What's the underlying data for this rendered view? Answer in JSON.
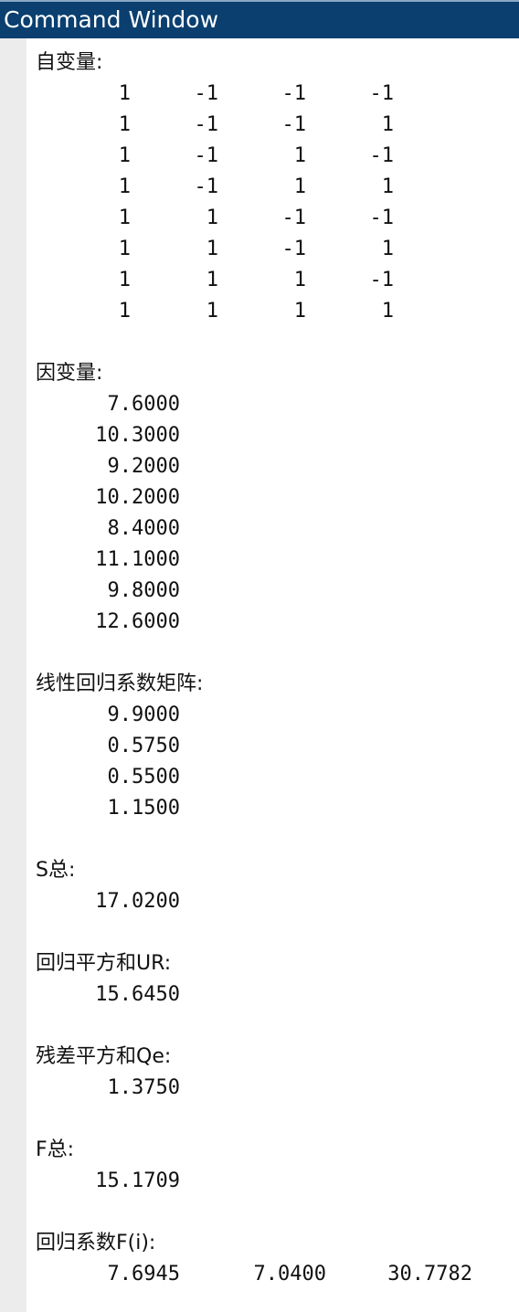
{
  "window": {
    "title": "Command Window"
  },
  "output": {
    "x_label": "自变量:",
    "x_matrix": [
      [
        "1",
        "-1",
        "-1",
        "-1"
      ],
      [
        "1",
        "-1",
        "-1",
        "1"
      ],
      [
        "1",
        "-1",
        "1",
        "-1"
      ],
      [
        "1",
        "-1",
        "1",
        "1"
      ],
      [
        "1",
        "1",
        "-1",
        "-1"
      ],
      [
        "1",
        "1",
        "-1",
        "1"
      ],
      [
        "1",
        "1",
        "1",
        "-1"
      ],
      [
        "1",
        "1",
        "1",
        "1"
      ]
    ],
    "y_label": "因变量:",
    "y_values": [
      "7.6000",
      "10.3000",
      "9.2000",
      "10.2000",
      "8.4000",
      "11.1000",
      "9.8000",
      "12.6000"
    ],
    "coef_label": "线性回归系数矩阵:",
    "coef_values": [
      "9.9000",
      "0.5750",
      "0.5500",
      "1.1500"
    ],
    "s_total_label": "S总:",
    "s_total_value": "17.0200",
    "ur_label": "回归平方和UR:",
    "ur_value": "15.6450",
    "qe_label": "残差平方和Qe:",
    "qe_value": "1.3750",
    "f_total_label": "F总:",
    "f_total_value": "15.1709",
    "f_i_label": "回归系数F(i):",
    "f_i_values": [
      "7.6945",
      "7.0400",
      "30.7782"
    ]
  },
  "colors": {
    "titlebar_bg": "#0a3f6f",
    "gutter_bg": "#ececec",
    "text": "#111111"
  }
}
